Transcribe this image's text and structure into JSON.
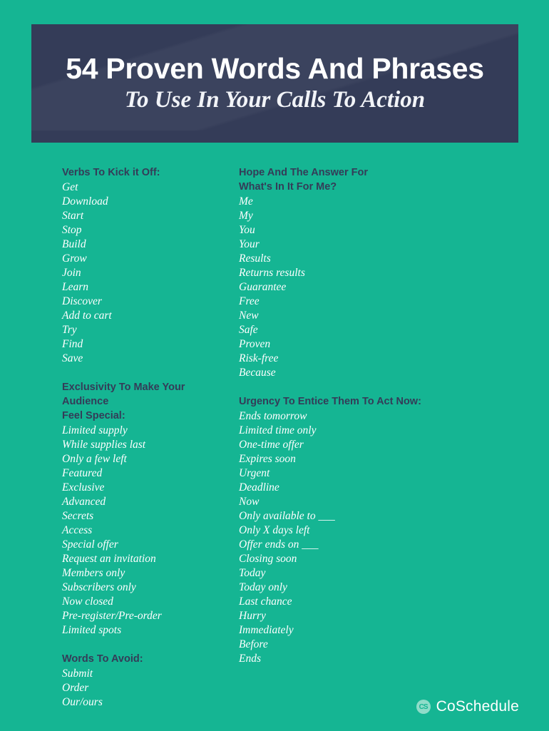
{
  "header": {
    "title": "54 Proven Words And Phrases",
    "subtitle": "To Use In Your Calls To Action"
  },
  "columns": {
    "left": [
      {
        "title": "Verbs To Kick it Off:",
        "items": [
          "Get",
          "Download",
          "Start",
          "Stop",
          "Build",
          "Grow",
          "Join",
          "Learn",
          "Discover",
          "Add to cart",
          "Try",
          "Find",
          "Save"
        ]
      },
      {
        "title": "Exclusivity To Make Your Audience\nFeel Special:",
        "items": [
          "Limited supply",
          "While supplies last",
          "Only a few left",
          "Featured",
          "Exclusive",
          "Advanced",
          "Secrets",
          "Access",
          "Special offer",
          "Request an invitation",
          "Members only",
          "Subscribers only",
          "Now closed",
          "Pre-register/Pre-order",
          "Limited spots"
        ]
      },
      {
        "title": "Words To Avoid:",
        "items": [
          "Submit",
          "Order",
          "Our/ours"
        ]
      }
    ],
    "right": [
      {
        "title": "Hope And The Answer For\nWhat's In It For Me?",
        "items": [
          "Me",
          "My",
          "You",
          "Your",
          "Results",
          "Returns results",
          "Guarantee",
          "Free",
          "New",
          "Safe",
          "Proven",
          "Risk-free",
          "Because"
        ]
      },
      {
        "title": "Urgency To Entice Them To Act Now:",
        "items": [
          "Ends tomorrow",
          "Limited time only",
          "One-time offer",
          "Expires soon",
          "Urgent",
          "Deadline",
          "Now",
          "Only available to ___",
          "Only X days left",
          "Offer ends on ___",
          "Closing soon",
          "Today",
          "Today only",
          "Last chance",
          "Hurry",
          "Immediately",
          "Before",
          "Ends"
        ]
      }
    ]
  },
  "footer": {
    "logo_mark": "cs-monogram-icon",
    "logo_mark_glyph": "CS",
    "brand": "CoSchedule"
  },
  "colors": {
    "background": "#15b593",
    "header_banner": "#343c58",
    "heading_text": "#343c58",
    "item_text": "#ffffff",
    "logo_mark": "#8fdcc9"
  }
}
